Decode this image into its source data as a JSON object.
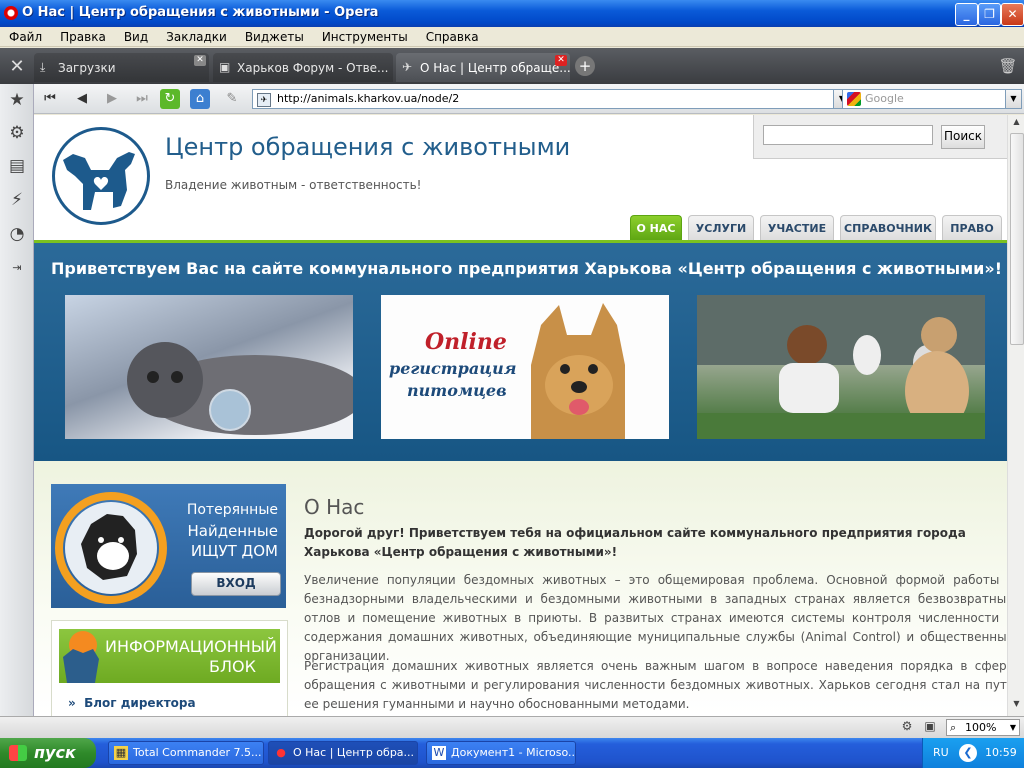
{
  "window": {
    "title": "О Нас | Центр обращения с животными - Opera"
  },
  "menu": [
    "Файл",
    "Правка",
    "Вид",
    "Закладки",
    "Виджеты",
    "Инструменты",
    "Справка"
  ],
  "tabs": [
    {
      "label": "Загрузки",
      "icon": "download-icon"
    },
    {
      "label": "Харьков Форум - Отве...",
      "icon": "forum-icon"
    },
    {
      "label": "О Нас | Центр обраще...",
      "icon": "page-icon"
    }
  ],
  "address": {
    "url": "http://animals.kharkov.ua/node/2"
  },
  "search": {
    "placeholder": "Google"
  },
  "site": {
    "title": "Центр обращения с животными",
    "slogan": "Владение животным - ответственность!",
    "search_button": "Поиск",
    "nav": [
      "О НАС",
      "УСЛУГИ",
      "УЧАСТИЕ",
      "СПРАВОЧНИК",
      "ПРАВО"
    ],
    "banner_title": "Приветствуем Вас на сайте коммунального предприятия Харькова «Центр обращения с животными»!",
    "promo": {
      "line1": "Online",
      "line2": "регистрация",
      "line3": "питомцев"
    },
    "lost": {
      "line1": "Потерянные",
      "line2": "Найденные",
      "line3": "ИЩУТ ДОМ",
      "button": "ВХОД"
    },
    "info": {
      "line1": "ИНФОРМАЦИОННЫЙ",
      "line2": "БЛОК",
      "link": "Блог директора"
    },
    "heading": "О Нас",
    "lead": "Дорогой друг! Приветствуем тебя на официальном сайте коммунального предприятия города Харькова «Центр обращения с животными»!",
    "para1": "Увеличение популяции бездомных животных – это общемировая проблема. Основной формой работы с безнадзорными владельческими и бездомными животными в западных странах является безвозвратный отлов и помещение животных в приюты. В развитых странах имеются системы контроля численности и содержания домашних животных, объединяющие муниципальные службы (Animal Control) и общественные организации.",
    "para2": "Регистрация домашних животных является очень важным шагом в вопросе наведения порядка в сфере обращения с животными и регулирования численности бездомных животных. Харьков сегодня стал на путь ее решения гуманными и научно обоснованными методами."
  },
  "status": {
    "zoom": "100%"
  },
  "taskbar": {
    "start": "пуск",
    "tasks": [
      "Total Commander 7.5...",
      "О Нас | Центр обра...",
      "Документ1 - Microso..."
    ],
    "lang": "RU",
    "clock": "10:59"
  },
  "colors": {
    "accent_green": "#7cc21f",
    "banner_blue": "#1d5f8f",
    "title_blue": "#225e8c"
  }
}
